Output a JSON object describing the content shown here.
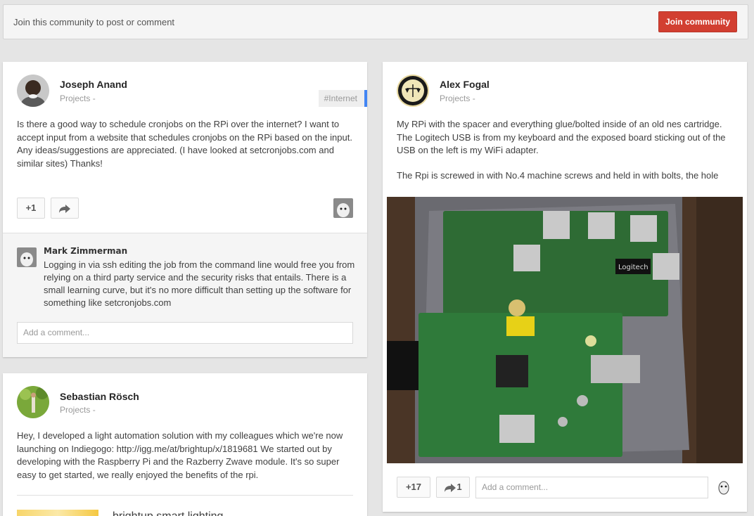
{
  "topbar": {
    "message": "Join this community to post or comment",
    "join_label": "Join community"
  },
  "posts": [
    {
      "author": "Joseph Anand",
      "category": "Projects",
      "tag": "#Internet",
      "text": "Is there a good way to schedule cronjobs on the RPi over the internet? I want to accept input from a website that schedules cronjobs on the RPi based on the input. Any ideas/suggestions are appreciated. (I have looked at setcronjobs.com and similar sites) Thanks!",
      "plus_one": "+1",
      "comments": [
        {
          "author": "Mark Zimmerman",
          "text": "Logging in via ssh editing the job from the command line would free you from relying on a third party service and the security risks that entails. There is a small learning curve, but it's no more difficult than setting up the software for something like setcronjobs.com"
        }
      ],
      "comment_placeholder": "Add a comment..."
    },
    {
      "author": "Sebastian Rösch",
      "category": "Projects",
      "text": "Hey, I developed a light automation solution with my colleagues which we're now launching on Indiegogo: http://igg.me/at/brightup/x/1819681 We started out by developing with the Raspberry Pi and the Razberry Zwave module. It's so super easy to get started, we really enjoyed the benefits of the rpi.",
      "link_title": "brightup smart lighting"
    },
    {
      "author": "Alex Fogal",
      "category": "Projects",
      "text": "My RPi with the spacer and everything glue/bolted inside of an old nes cartridge. The Logitech USB is from my keyboard and the exposed board sticking out of the USB on the left is my WiFi adapter.",
      "text2": "The Rpi is screwed in with No.4 machine screws and held in with bolts, the hole",
      "plus_one": "+17",
      "share_count": "1",
      "comment_placeholder": "Add a comment...",
      "photo_label": "Logitech"
    }
  ],
  "colors": {
    "accent_red": "#d23f31",
    "tag_blue": "#4285f4"
  }
}
